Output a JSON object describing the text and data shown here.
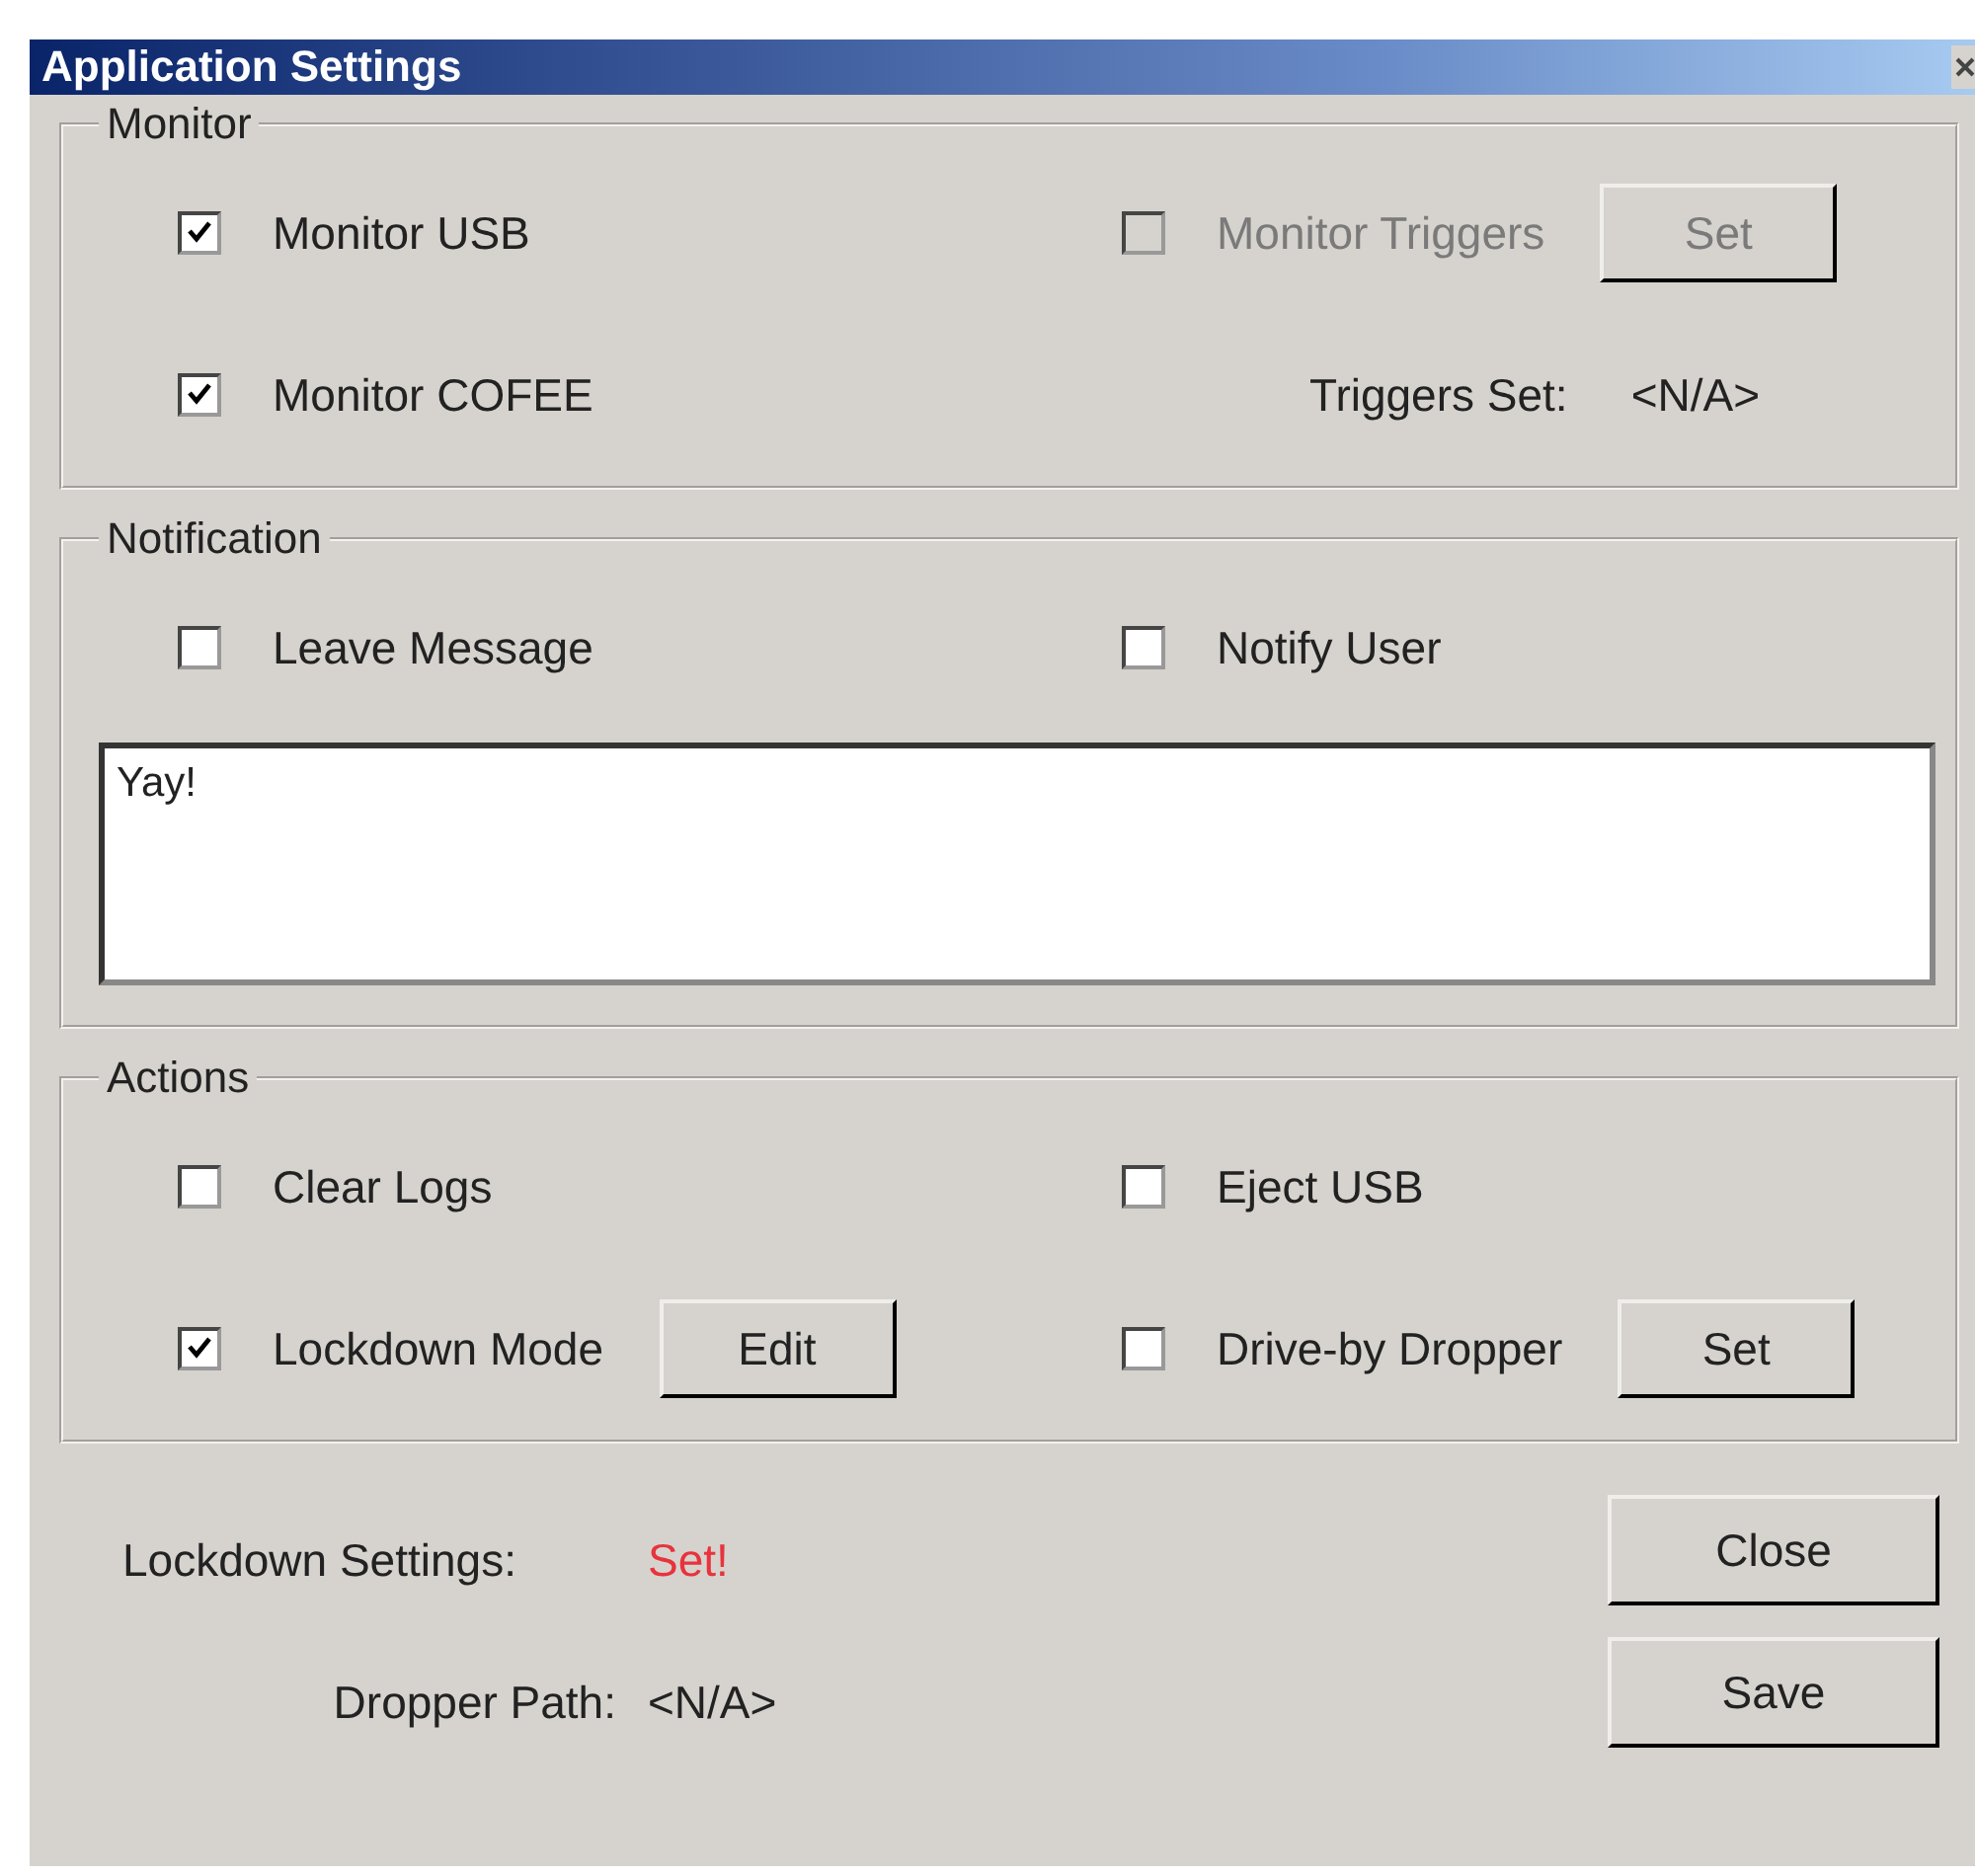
{
  "window": {
    "title": "Application Settings"
  },
  "sections": [
    {
      "legend": "Monitor",
      "rows": [
        [
          {
            "kind": "checkbox",
            "label": "Monitor USB",
            "checked": true,
            "disabled": false
          },
          {
            "kind": "checkbox",
            "label": "Monitor Triggers",
            "checked": false,
            "disabled": true,
            "button": {
              "label": "Set",
              "disabled": true
            }
          }
        ],
        [
          {
            "kind": "checkbox",
            "label": "Monitor COFEE",
            "checked": true,
            "disabled": false
          },
          {
            "kind": "readout",
            "label": "Triggers Set:",
            "value": "<N/A>"
          }
        ]
      ]
    },
    {
      "legend": "Notification",
      "rows": [
        [
          {
            "kind": "checkbox",
            "label": "Leave Message",
            "checked": false,
            "disabled": false
          },
          {
            "kind": "checkbox",
            "label": "Notify User",
            "checked": false,
            "disabled": false
          }
        ]
      ],
      "message": "Yay!"
    },
    {
      "legend": "Actions",
      "rows": [
        [
          {
            "kind": "checkbox",
            "label": "Clear Logs",
            "checked": false,
            "disabled": false
          },
          {
            "kind": "checkbox",
            "label": "Eject USB",
            "checked": false,
            "disabled": false
          }
        ],
        [
          {
            "kind": "checkbox",
            "label": "Lockdown Mode",
            "checked": true,
            "disabled": false,
            "button": {
              "label": "Edit",
              "disabled": false
            }
          },
          {
            "kind": "checkbox",
            "label": "Drive-by Dropper",
            "checked": false,
            "disabled": false,
            "button": {
              "label": "Set",
              "disabled": false
            }
          }
        ]
      ]
    }
  ],
  "footer": {
    "lockdown_label": "Lockdown Settings:",
    "lockdown_value": "Set!",
    "dropper_label": "Dropper Path:",
    "dropper_value": "<N/A>",
    "buttons": [
      "Close",
      "Save"
    ]
  }
}
